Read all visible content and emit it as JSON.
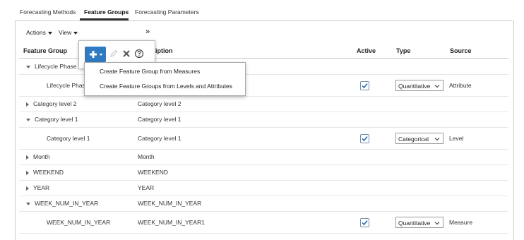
{
  "tabs": [
    {
      "label": "Forecasting Methods",
      "active": false
    },
    {
      "label": "Feature Groups",
      "active": true
    },
    {
      "label": "Forecasting Parameters",
      "active": false
    }
  ],
  "toolbar": {
    "actions_label": "Actions",
    "view_label": "View",
    "overflow_label": "»"
  },
  "columns": {
    "feature_group": "Feature Group",
    "description": "Description",
    "active": "Active",
    "type": "Type",
    "source": "Source"
  },
  "rows": [
    {
      "name": "Lifecycle Phase",
      "description": "",
      "expander": "expanded",
      "indent": false,
      "active": null,
      "type": "",
      "source": ""
    },
    {
      "name": "Lifecycle Phase",
      "description": "",
      "expander": "none",
      "indent": true,
      "active": true,
      "type": "Quantitative",
      "source": "Attribute"
    },
    {
      "name": "Category level 2",
      "description": "Category level 2",
      "expander": "collapsed",
      "indent": false,
      "active": null,
      "type": "",
      "source": ""
    },
    {
      "name": "Category level 1",
      "description": "Category level 1",
      "expander": "expanded",
      "indent": false,
      "active": null,
      "type": "",
      "source": ""
    },
    {
      "name": "Category level 1",
      "description": "Category level 1",
      "expander": "none",
      "indent": true,
      "active": true,
      "type": "Categorical",
      "source": "Level"
    },
    {
      "name": "Month",
      "description": "Month",
      "expander": "collapsed",
      "indent": false,
      "active": null,
      "type": "",
      "source": ""
    },
    {
      "name": "WEEKEND",
      "description": "WEEKEND",
      "expander": "collapsed",
      "indent": false,
      "active": null,
      "type": "",
      "source": ""
    },
    {
      "name": "YEAR",
      "description": "YEAR",
      "expander": "collapsed",
      "indent": false,
      "active": null,
      "type": "",
      "source": ""
    },
    {
      "name": "WEEK_NUM_IN_YEAR",
      "description": "WEEK_NUM_IN_YEAR",
      "expander": "expanded",
      "indent": false,
      "active": null,
      "type": "",
      "source": ""
    },
    {
      "name": "WEEK_NUM_IN_YEAR",
      "description": "WEEK_NUM_IN_YEAR1",
      "expander": "none",
      "indent": true,
      "active": true,
      "type": "Quantitative",
      "source": "Measure"
    }
  ],
  "popover": {
    "icons": [
      "add-icon",
      "edit-icon",
      "delete-icon",
      "help-icon"
    ]
  },
  "menu": {
    "items": [
      "Create Feature Group from Measures",
      "Create Feature Groups from Levels and Attributes"
    ]
  },
  "colors": {
    "accent": "#2e7bc4",
    "checkbox_border": "#7a8da3",
    "check": "#2e6fb3"
  }
}
